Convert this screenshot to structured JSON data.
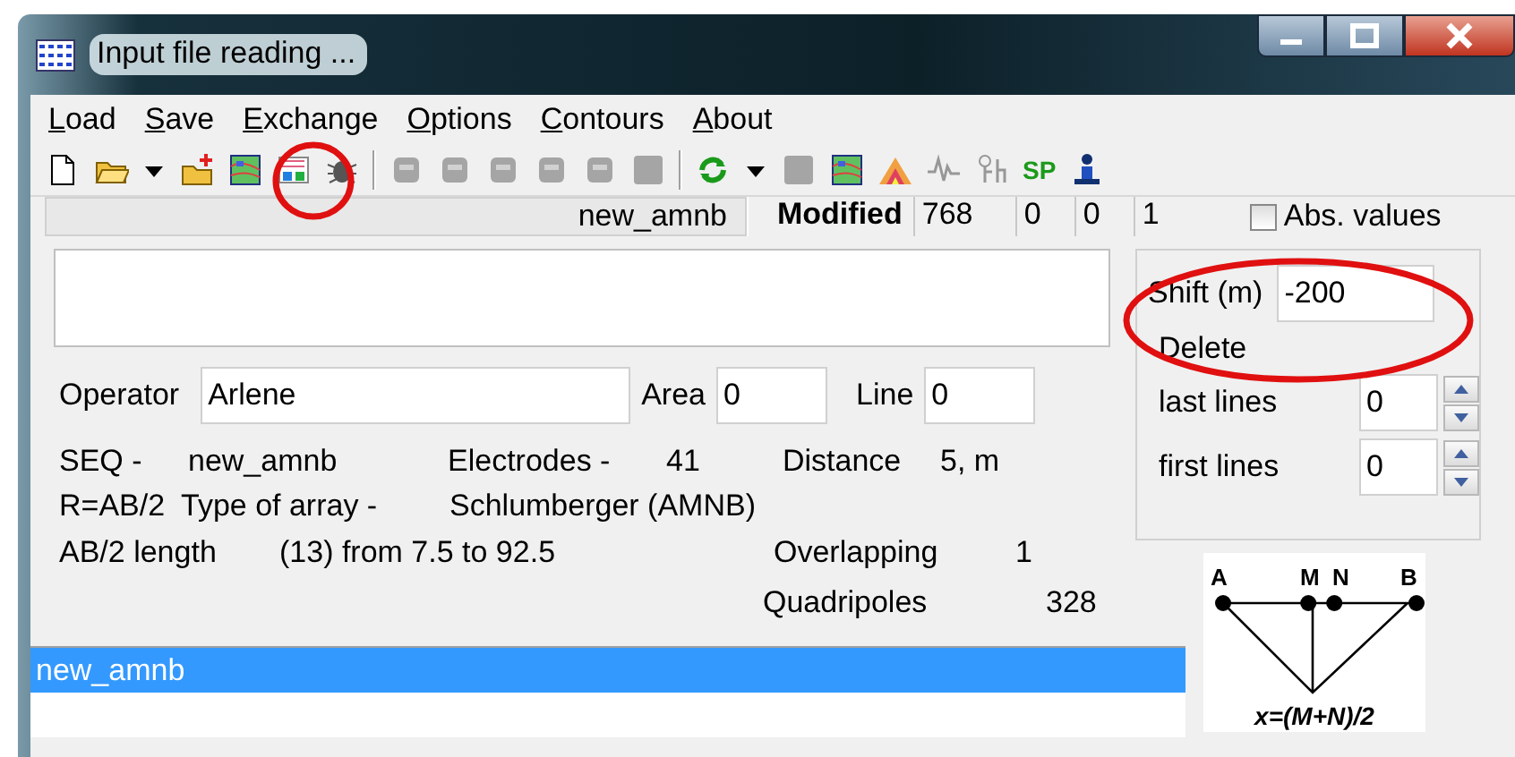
{
  "window": {
    "title": "Input file reading ..."
  },
  "menu": [
    "Load",
    "Save",
    "Exchange",
    "Options",
    "Contours",
    "About"
  ],
  "toolbar": [
    {
      "kind": "document",
      "disabled": false
    },
    {
      "kind": "folder",
      "disabled": false
    },
    {
      "kind": "caret",
      "disabled": false
    },
    {
      "kind": "folder-plus",
      "disabled": false
    },
    {
      "kind": "map",
      "disabled": false
    },
    {
      "kind": "chart",
      "disabled": false
    },
    {
      "kind": "bug",
      "disabled": false
    },
    {
      "kind": "separator"
    },
    {
      "kind": "tile",
      "disabled": true
    },
    {
      "kind": "tile",
      "disabled": true
    },
    {
      "kind": "tile",
      "disabled": true
    },
    {
      "kind": "tile",
      "disabled": true
    },
    {
      "kind": "tile",
      "disabled": true
    },
    {
      "kind": "square",
      "disabled": true
    },
    {
      "kind": "separator"
    },
    {
      "kind": "refresh",
      "disabled": false
    },
    {
      "kind": "caret",
      "disabled": false
    },
    {
      "kind": "square",
      "disabled": true
    },
    {
      "kind": "map",
      "disabled": false
    },
    {
      "kind": "mountain",
      "disabled": false
    },
    {
      "kind": "wave",
      "disabled": true
    },
    {
      "kind": "figure",
      "disabled": true
    },
    {
      "kind": "text",
      "label": "SP",
      "disabled": false
    },
    {
      "kind": "person",
      "disabled": false
    }
  ],
  "status_bar": {
    "file": "new_amnb",
    "state": "Modified",
    "fields": [
      "768",
      "0",
      "0",
      "1"
    ],
    "abs_values": {
      "label": "Abs. values",
      "checked": false
    }
  },
  "operator": {
    "label": "Operator",
    "value": "Arlene"
  },
  "area": {
    "label": "Area",
    "value": "0"
  },
  "line": {
    "label": "Line",
    "value": "0"
  },
  "info": [
    [
      "SEQ -",
      "new_amnb",
      "Electrodes -",
      "41",
      "Distance",
      "5, m"
    ],
    [
      "R=AB/2",
      "Type of array  -",
      "Schlumberger (AMNB)"
    ],
    [
      "AB/2 length",
      "(13) from 7.5 to 92.5",
      "Overlapping",
      "1"
    ],
    [
      "Quadripoles",
      "328"
    ]
  ],
  "shift": {
    "label": "Shift (m)",
    "value": "-200"
  },
  "delete": {
    "label": "Delete",
    "rows": [
      {
        "label": "last lines",
        "value": "0"
      },
      {
        "label": "first lines",
        "value": "0"
      }
    ]
  },
  "diagram": {
    "labels": [
      "A",
      "M",
      "N",
      "B"
    ],
    "formula": "x=(M+N)/2"
  },
  "files": [
    {
      "name": "new_amnb",
      "selected": true
    }
  ]
}
